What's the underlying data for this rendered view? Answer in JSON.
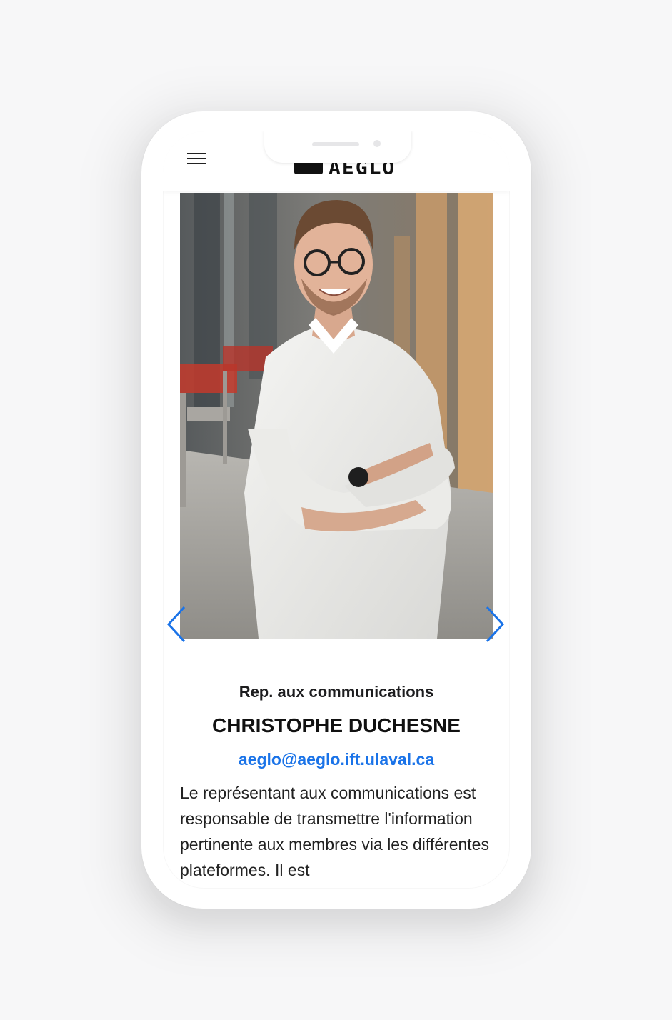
{
  "header": {
    "logo_text": "AEGLO",
    "menu_icon": "hamburger-icon"
  },
  "carousel": {
    "prev_icon": "chevron-left-icon",
    "next_icon": "chevron-right-icon",
    "photo_subject": "person-photo"
  },
  "profile": {
    "role": "Rep. aux communications",
    "name": "CHRISTOPHE DUCHESNE",
    "email": "aeglo@aeglo.ift.ulaval.ca",
    "description": "Le représentant aux communications est responsable de transmettre l'information pertinente aux membres via les différentes plateformes. Il est"
  },
  "colors": {
    "accent": "#1a73e8",
    "background": "#f7f7f8",
    "text": "#222222"
  }
}
